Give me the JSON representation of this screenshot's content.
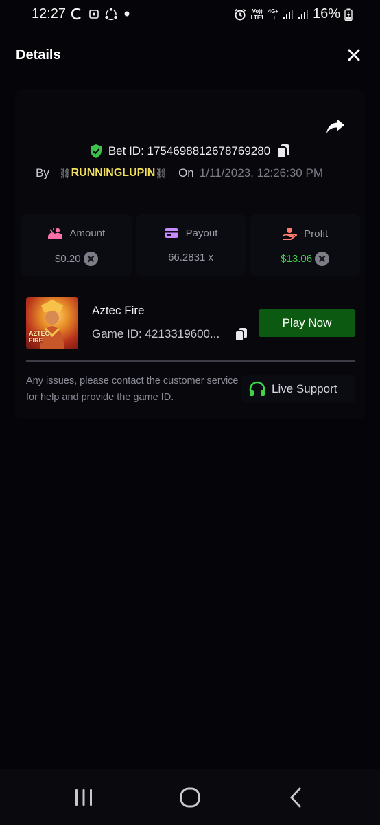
{
  "status_bar": {
    "time": "12:27",
    "battery": "16%",
    "network_top": "Vo))",
    "network_bottom": "LTE1",
    "network_type": "4G+"
  },
  "header": {
    "title": "Details"
  },
  "bet": {
    "bet_id": "Bet ID: 1754698812678769280",
    "by_label": "By",
    "chain_left": "⛓",
    "username": "RUNNINGLUPIN",
    "chain_right": "⛓",
    "on_label": "On",
    "date": "1/11/2023, 12:26:30 PM"
  },
  "stats": {
    "amount_label": "Amount",
    "amount_value": "$0.20",
    "payout_label": "Payout",
    "payout_value": "66.2831 x",
    "profit_label": "Profit",
    "profit_value": "$13.06"
  },
  "game": {
    "name": "Aztec Fire",
    "thumb_text_line1": "AZTEC",
    "thumb_text_line2": "FIRE",
    "game_id": "Game ID: 4213319600...",
    "play_label": "Play Now"
  },
  "support": {
    "note": "Any issues, please contact the customer service for help and provide the game ID.",
    "button_label": "Live Support"
  },
  "colors": {
    "accent_green": "#0c5a12",
    "profit_green": "#3fd44a",
    "username_yellow": "#f3df5a",
    "shield_green": "#3cc24a",
    "support_green": "#3fd44a"
  },
  "icons": [
    "close-icon",
    "share-icon",
    "shield-check-icon",
    "copy-icon",
    "amount-icon",
    "card-icon",
    "hand-heart-icon",
    "coin-x-icon",
    "headset-icon",
    "recents-icon",
    "home-icon",
    "back-icon"
  ]
}
